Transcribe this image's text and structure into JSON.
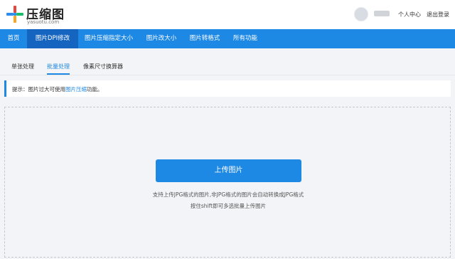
{
  "header": {
    "brand_name": "压缩图",
    "brand_domain": "yasuotu.com",
    "user_center": "个人中心",
    "logout": "退出登录"
  },
  "nav": {
    "items": [
      {
        "label": "首页"
      },
      {
        "label": "图片DPI修改"
      },
      {
        "label": "图片压缩指定大小"
      },
      {
        "label": "图片改大小"
      },
      {
        "label": "图片转格式"
      },
      {
        "label": "所有功能"
      }
    ],
    "active_index": 1
  },
  "subtabs": {
    "items": [
      {
        "label": "单张处理"
      },
      {
        "label": "批量处理"
      },
      {
        "label": "像素尺寸换算器"
      }
    ],
    "active_index": 1
  },
  "tip": {
    "prefix": "提示：图片过大可使用",
    "link": "图片压缩",
    "suffix": "功能。"
  },
  "upload": {
    "button_label": "上传图片",
    "hint_line1": "支持上传JPG格式的图片,非JPG格式的图片会自动转换成JPG格式",
    "hint_line2": "按住shift即可多选批量上传图片"
  },
  "colors": {
    "accent": "#1e88e5",
    "nav_active": "#1565c0"
  }
}
